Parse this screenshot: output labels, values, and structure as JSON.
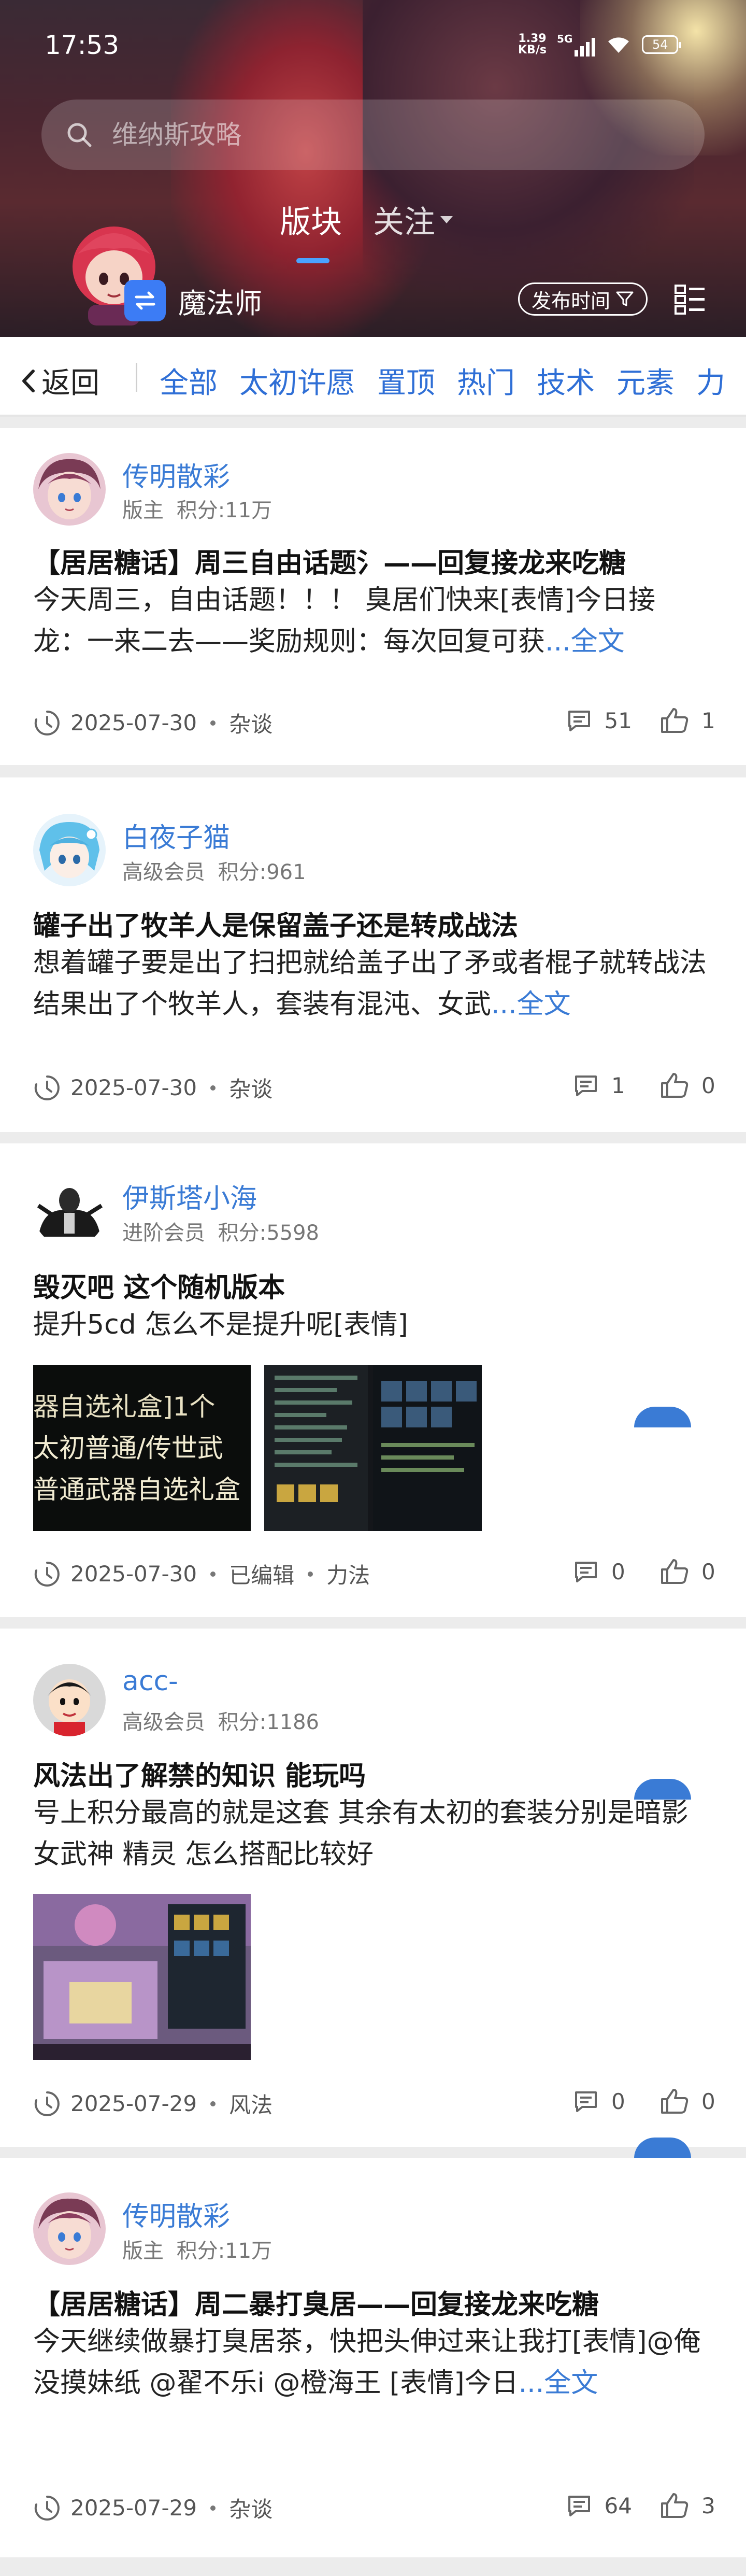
{
  "status_bar": {
    "time": "17:53",
    "net_speed_value": "1.39",
    "net_speed_unit": "KB/s",
    "network_type": "5G",
    "battery": "54"
  },
  "search": {
    "placeholder": "维纳斯攻略"
  },
  "top_tabs": [
    {
      "label": "版块",
      "active": true
    },
    {
      "label": "关注",
      "active": false
    }
  ],
  "forum": {
    "job_name": "魔法师",
    "sort_label": "发布时间",
    "icons": {
      "job": "swap-arrows-icon",
      "sort": "filter-funnel-icon",
      "view": "list-grid-icon"
    }
  },
  "categories": {
    "back_label": "返回",
    "items": [
      "全部",
      "太初许愿",
      "置顶",
      "热门",
      "技术",
      "元素",
      "力"
    ]
  },
  "colors": {
    "accent": "#3a7bd5",
    "job_icon_bg": "#3c7cf5"
  },
  "posts": [
    {
      "user": "传明散彩",
      "role": "版主",
      "points": "积分:11万",
      "title": "【居居糖话】周三自由话题氵——回复接龙来吃糖",
      "body": "今天周三，自由话题！！！ 臭居们快来[表情]今日接龙：一来二去——奖励规则：每次回复可获",
      "more": "...全文",
      "date": "2025-07-30",
      "tags": [
        "杂谈"
      ],
      "comments": "51",
      "likes": "1"
    },
    {
      "user": "白夜子猫",
      "role": "高级会员",
      "points": "积分:961",
      "title": "罐子出了牧羊人是保留盖子还是转成战法",
      "body": "想着罐子要是出了扫把就给盖子出了矛或者棍子就转战法 结果出了个牧羊人，套装有混沌、女武",
      "more": "...全文",
      "date": "2025-07-30",
      "tags": [
        "杂谈"
      ],
      "comments": "1",
      "likes": "0"
    },
    {
      "user": "伊斯塔小海",
      "role": "进阶会员",
      "points": "积分:5598",
      "title": "毁灭吧 这个随机版本",
      "body": " 提升5cd 怎么不是提升呢[表情]",
      "images": [
        {
          "caption_lines": [
            "器自选礼盒]1个",
            "太初普通/传世武",
            "普通武器自选礼盒"
          ]
        },
        {
          "caption_lines": []
        }
      ],
      "date": "2025-07-30",
      "tags": [
        "已编辑",
        "力法"
      ],
      "comments": "0",
      "likes": "0"
    },
    {
      "user": "acc-",
      "role": "高级会员",
      "points": "积分:1186",
      "title": "风法出了解禁的知识 能玩吗",
      "body": "号上积分最高的就是这套 其余有太初的套装分别是暗影 女武神 精灵 怎么搭配比较好",
      "images": [
        {
          "caption_lines": []
        }
      ],
      "date": "2025-07-29",
      "tags": [
        "风法"
      ],
      "comments": "0",
      "likes": "0"
    },
    {
      "user": "传明散彩",
      "role": "版主",
      "points": "积分:11万",
      "title": "【居居糖话】周二暴打臭居——回复接龙来吃糖",
      "body": "今天继续做暴打臭居茶，快把头伸过来让我打[表情]@俺没摸妹纸 @翟不乐i @橙海王 [表情]今日",
      "more": "...全文",
      "date": "2025-07-29",
      "tags": [
        "杂谈"
      ],
      "comments": "64",
      "likes": "3"
    }
  ]
}
